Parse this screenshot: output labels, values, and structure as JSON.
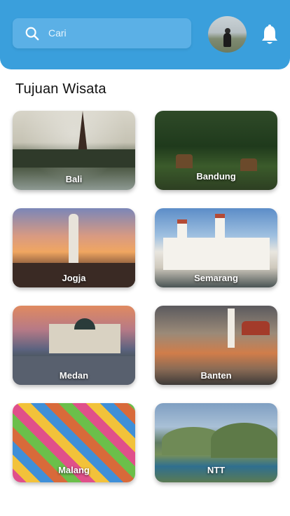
{
  "header": {
    "search": {
      "placeholder": "Cari",
      "icon": "search-icon"
    },
    "avatar": "profile-avatar",
    "notification_icon": "bell-icon",
    "background": "#3a9fdc"
  },
  "section": {
    "title": "Tujuan Wisata"
  },
  "destinations": [
    {
      "label": "Bali"
    },
    {
      "label": "Bandung"
    },
    {
      "label": "Jogja"
    },
    {
      "label": "Semarang"
    },
    {
      "label": "Medan"
    },
    {
      "label": "Banten"
    },
    {
      "label": "Malang"
    },
    {
      "label": "NTT"
    }
  ]
}
